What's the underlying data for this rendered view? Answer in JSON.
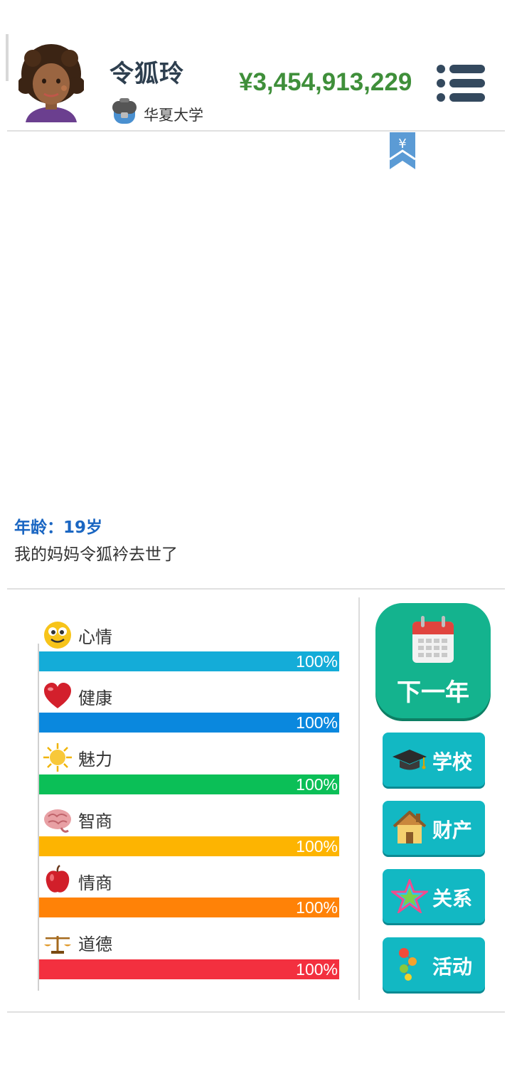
{
  "header": {
    "name": "令狐玲",
    "school": "华夏大学",
    "money": "¥3,454,913,229"
  },
  "bookmark_symbol": "¥",
  "log": {
    "age": "年龄：19岁",
    "message": "我的妈妈令狐衿去世了"
  },
  "stats": [
    {
      "label": "心情",
      "value": "100%",
      "fraction": 1.0,
      "color": "#14acd8",
      "icon": "smiley-icon"
    },
    {
      "label": "健康",
      "value": "100%",
      "fraction": 1.0,
      "color": "#0a88de",
      "icon": "heart-icon"
    },
    {
      "label": "魅力",
      "value": "100%",
      "fraction": 1.0,
      "color": "#0bbf57",
      "icon": "sun-icon"
    },
    {
      "label": "智商",
      "value": "100%",
      "fraction": 1.0,
      "color": "#fdb401",
      "icon": "brain-icon"
    },
    {
      "label": "情商",
      "value": "100%",
      "fraction": 1.0,
      "color": "#ff8207",
      "icon": "apple-icon"
    },
    {
      "label": "道德",
      "value": "100%",
      "fraction": 1.0,
      "color": "#f3303f",
      "icon": "scales-icon"
    }
  ],
  "actions": {
    "next_year": "下一年",
    "school": "学校",
    "property": "财产",
    "relations": "关系",
    "activities": "活动"
  }
}
